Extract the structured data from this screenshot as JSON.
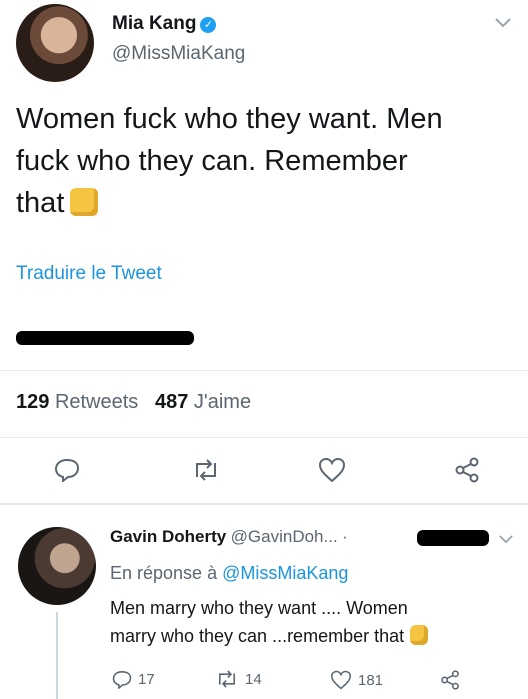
{
  "tweet": {
    "author_name": "Mia Kang",
    "author_handle": "@MissMiaKang",
    "text_lines": [
      "Women fuck who they want. Men",
      "fuck who they can. Remember",
      "that"
    ],
    "translate_label": "Traduire le Tweet",
    "stats": {
      "retweets_count": "129",
      "retweets_label": "Retweets",
      "likes_count": "487",
      "likes_label": "J'aime"
    },
    "actions": [
      "reply",
      "retweet",
      "like",
      "share"
    ]
  },
  "reply": {
    "author_name": "Gavin Doherty",
    "author_handle": "@GavinDoh...",
    "separator": "·",
    "context_prefix": "En réponse à",
    "context_handle": "@MissMiaKang",
    "text_lines": [
      "Men marry who they want .... Women",
      "marry who they can ...remember that"
    ],
    "counts": {
      "replies": "17",
      "retweets": "14",
      "likes": "181"
    }
  },
  "colors": {
    "link": "#1b95e0",
    "verified": "#1da1f2",
    "muted": "#5b6670",
    "divider": "#e6ecf0"
  }
}
